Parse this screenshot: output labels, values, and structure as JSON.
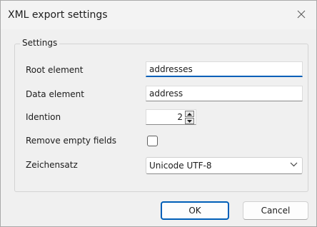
{
  "window": {
    "title": "XML export settings",
    "close_icon": "close-icon"
  },
  "settings": {
    "group_label": "Settings",
    "root_element": {
      "label": "Root element",
      "value": "addresses"
    },
    "data_element": {
      "label": "Data element",
      "value": "address"
    },
    "indention": {
      "label": "Idention",
      "value": "2"
    },
    "remove_empty": {
      "label": "Remove empty fields",
      "checked": false
    },
    "charset": {
      "label": "Zeichensatz",
      "value": "Unicode UTF-8"
    }
  },
  "buttons": {
    "ok_label": "OK",
    "cancel_label": "Cancel"
  },
  "colors": {
    "accent": "#005fb8",
    "background": "#f0f0f0"
  }
}
